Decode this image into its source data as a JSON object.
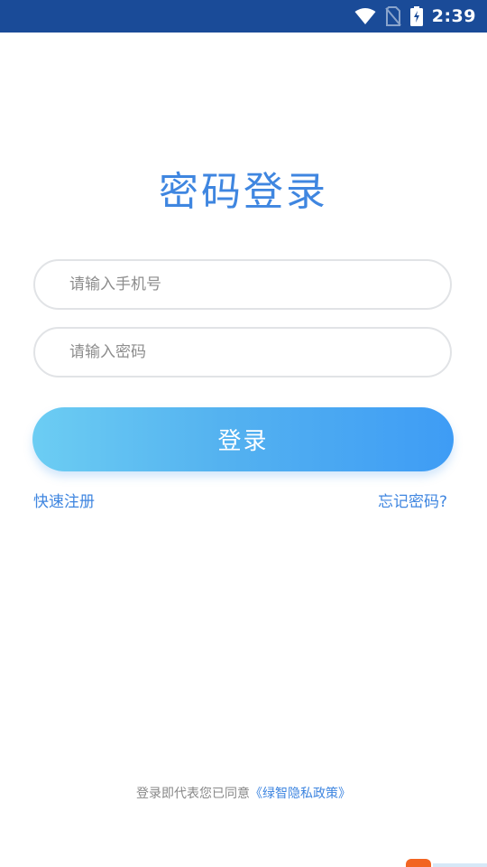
{
  "status_bar": {
    "time": "2:39",
    "icons": [
      "wifi-icon",
      "no-sim-icon",
      "battery-charging-icon"
    ],
    "background": "#1a4b98"
  },
  "page": {
    "title": "密码登录"
  },
  "form": {
    "phone_placeholder": "请输入手机号",
    "password_placeholder": "请输入密码",
    "login_label": "登录"
  },
  "links": {
    "register": "快速注册",
    "forgot": "忘记密码?"
  },
  "agreement": {
    "prefix": "登录即代表您已同意",
    "policy": "《绿智隐私政策》"
  },
  "colors": {
    "accent": "#3f86e0",
    "button_gradient_start": "#6ccdf3",
    "button_gradient_end": "#3e9cf5"
  }
}
